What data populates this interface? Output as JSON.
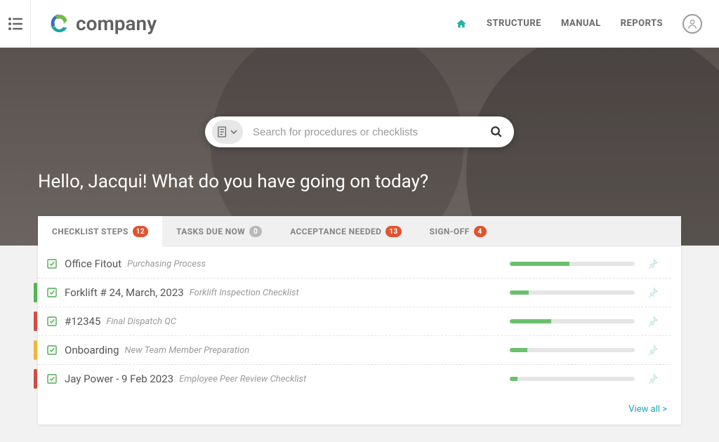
{
  "brand": {
    "name": "company"
  },
  "nav": {
    "links": [
      "STRUCTURE",
      "MANUAL",
      "REPORTS"
    ]
  },
  "search": {
    "placeholder": "Search for procedures or checklists"
  },
  "greeting": "Hello, Jacqui! What do you have going on today?",
  "tabs": [
    {
      "label": "CHECKLIST STEPS",
      "badge": "12",
      "badge_color": "#e1532f",
      "active": true
    },
    {
      "label": "TASKS DUE NOW",
      "badge": "0",
      "badge_color": "grey",
      "active": false
    },
    {
      "label": "ACCEPTANCE NEEDED",
      "badge": "13",
      "badge_color": "#e1532f",
      "active": false
    },
    {
      "label": "SIGN-OFF",
      "badge": "4",
      "badge_color": "#e1532f",
      "active": false
    }
  ],
  "rows": [
    {
      "title": "Office Fitout",
      "subtitle": "Purchasing Process",
      "progress": 48,
      "accent": ""
    },
    {
      "title": "Forklift # 24, March, 2023",
      "subtitle": "Forklift Inspection Checklist",
      "progress": 15,
      "accent": "#4fb84f"
    },
    {
      "title": "#12345",
      "subtitle": "Final Dispatch QC",
      "progress": 33,
      "accent": "#d84b3e"
    },
    {
      "title": "Onboarding",
      "subtitle": "New Team Member Preparation",
      "progress": 14,
      "accent": "#f2b63b"
    },
    {
      "title": "Jay Power - 9 Feb 2023",
      "subtitle": "Employee Peer Review Checklist",
      "progress": 6,
      "accent": "#cf4d3f"
    }
  ],
  "viewall": "View all >"
}
